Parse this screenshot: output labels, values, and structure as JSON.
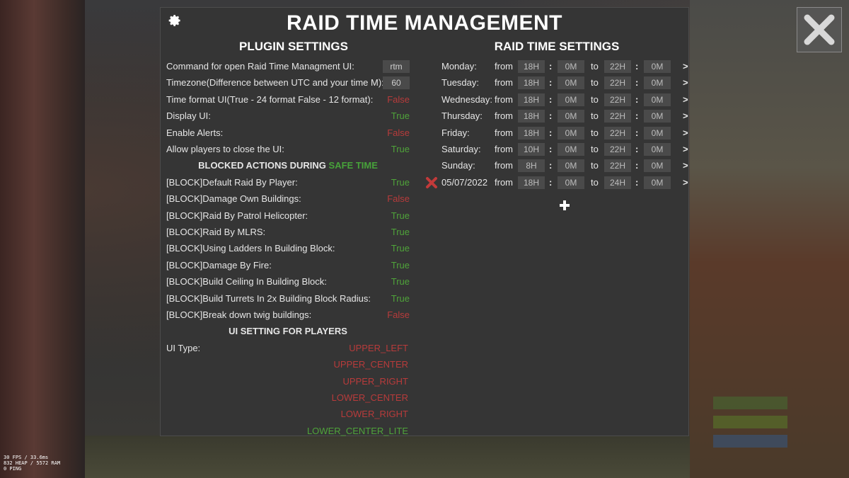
{
  "window": {
    "title": "RAID TIME MANAGEMENT"
  },
  "plugin": {
    "heading": "PLUGIN SETTINGS",
    "settings": [
      {
        "label": "Command for open Raid Time Managment UI:",
        "value": "rtm",
        "kind": "input"
      },
      {
        "label": "Timezone(Difference between UTC and your time M):",
        "value": "60",
        "kind": "input"
      },
      {
        "label": "Time format UI(True - 24 format False - 12 format):",
        "value": "False",
        "kind": "bool"
      },
      {
        "label": "Display UI:",
        "value": "True",
        "kind": "bool"
      },
      {
        "label": "Enable Alerts:",
        "value": "False",
        "kind": "bool"
      },
      {
        "label": "Allow players to close the UI:",
        "value": "True",
        "kind": "bool"
      }
    ],
    "blocked_heading": "BLOCKED ACTIONS DURING",
    "blocked_heading_highlight": "SAFE TIME",
    "blocked": [
      {
        "label": "[BLOCK]Default Raid By Player:",
        "value": "True"
      },
      {
        "label": "[BLOCK]Damage Own Buildings:",
        "value": "False"
      },
      {
        "label": "[BLOCK]Raid By Patrol Helicopter:",
        "value": "True"
      },
      {
        "label": "[BLOCK]Raid By MLRS:",
        "value": "True"
      },
      {
        "label": "[BLOCK]Using Ladders In Building Block:",
        "value": "True"
      },
      {
        "label": "[BLOCK]Damage By Fire:",
        "value": "True"
      },
      {
        "label": "[BLOCK]Build Ceiling In Building Block:",
        "value": "True"
      },
      {
        "label": "[BLOCK]Build Turrets In 2x Building Block Radius:",
        "value": "True"
      },
      {
        "label": "[BLOCK]Break down twig buildings:",
        "value": "False"
      }
    ],
    "ui_heading": "UI SETTING FOR PLAYERS",
    "ui_type_label": "UI Type:",
    "ui_types": [
      {
        "label": "UPPER_LEFT",
        "selected": false
      },
      {
        "label": "UPPER_CENTER",
        "selected": false
      },
      {
        "label": "UPPER_RIGHT",
        "selected": false
      },
      {
        "label": "LOWER_CENTER",
        "selected": false
      },
      {
        "label": "LOWER_RIGHT",
        "selected": false
      },
      {
        "label": "LOWER_CENTER_LITE",
        "selected": true
      }
    ]
  },
  "raid": {
    "heading": "RAID TIME SETTINGS",
    "from_label": "from",
    "to_label": "to",
    "colon": ":",
    "arrow": ">",
    "days": [
      {
        "day": "Monday:",
        "from_h": "18H",
        "from_m": "0M",
        "to_h": "22H",
        "to_m": "0M"
      },
      {
        "day": "Tuesday:",
        "from_h": "18H",
        "from_m": "0M",
        "to_h": "22H",
        "to_m": "0M"
      },
      {
        "day": "Wednesday:",
        "from_h": "18H",
        "from_m": "0M",
        "to_h": "22H",
        "to_m": "0M"
      },
      {
        "day": "Thursday:",
        "from_h": "18H",
        "from_m": "0M",
        "to_h": "22H",
        "to_m": "0M"
      },
      {
        "day": "Friday:",
        "from_h": "18H",
        "from_m": "0M",
        "to_h": "22H",
        "to_m": "0M"
      },
      {
        "day": "Saturday:",
        "from_h": "10H",
        "from_m": "0M",
        "to_h": "22H",
        "to_m": "0M"
      },
      {
        "day": "Sunday:",
        "from_h": "8H",
        "from_m": "0M",
        "to_h": "22H",
        "to_m": "0M"
      },
      {
        "day": "05/07/2022",
        "from_h": "18H",
        "from_m": "0M",
        "to_h": "24H",
        "to_m": "0M",
        "removable": true
      }
    ]
  },
  "hud": {
    "fps_lines": [
      "30 FPS / 33.6ms",
      "832 HEAP / 5572 RAM",
      "0 PING"
    ]
  },
  "colors": {
    "true": "#4fa33a",
    "false": "#b83b3b",
    "panel": "#353535"
  }
}
